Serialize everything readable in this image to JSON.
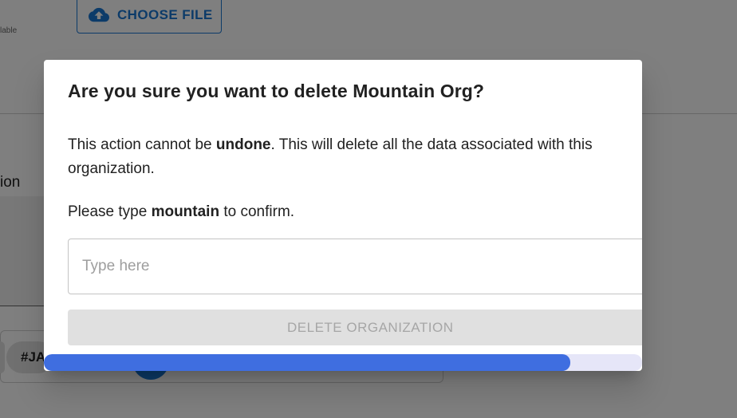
{
  "background": {
    "choose_file_label": "CHOOSE FILE",
    "available_fragment": "lable",
    "section_label_fragment": "ion",
    "chip_fragment": "#JA"
  },
  "dialog": {
    "title": "Are you sure you want to delete Mountain Org?",
    "message_pre": "This action cannot be ",
    "message_bold": "undone",
    "message_post": ". This will delete all the data associated with this organization.",
    "confirm_pre": "Please type ",
    "confirm_bold": "mountain",
    "confirm_post": " to confirm.",
    "input_value": "",
    "input_placeholder": "Type here",
    "delete_button_label": "DELETE ORGANIZATION",
    "delete_button_disabled": true,
    "progress_percent": 88
  },
  "colors": {
    "primary": "#1976d2",
    "progress_fill": "#3f6ee0",
    "progress_track": "#e6e6f8",
    "disabled_button_bg": "#e0e0e0",
    "disabled_button_text": "#a6a6a6"
  },
  "icons": {
    "upload": "cloud-upload-icon"
  }
}
